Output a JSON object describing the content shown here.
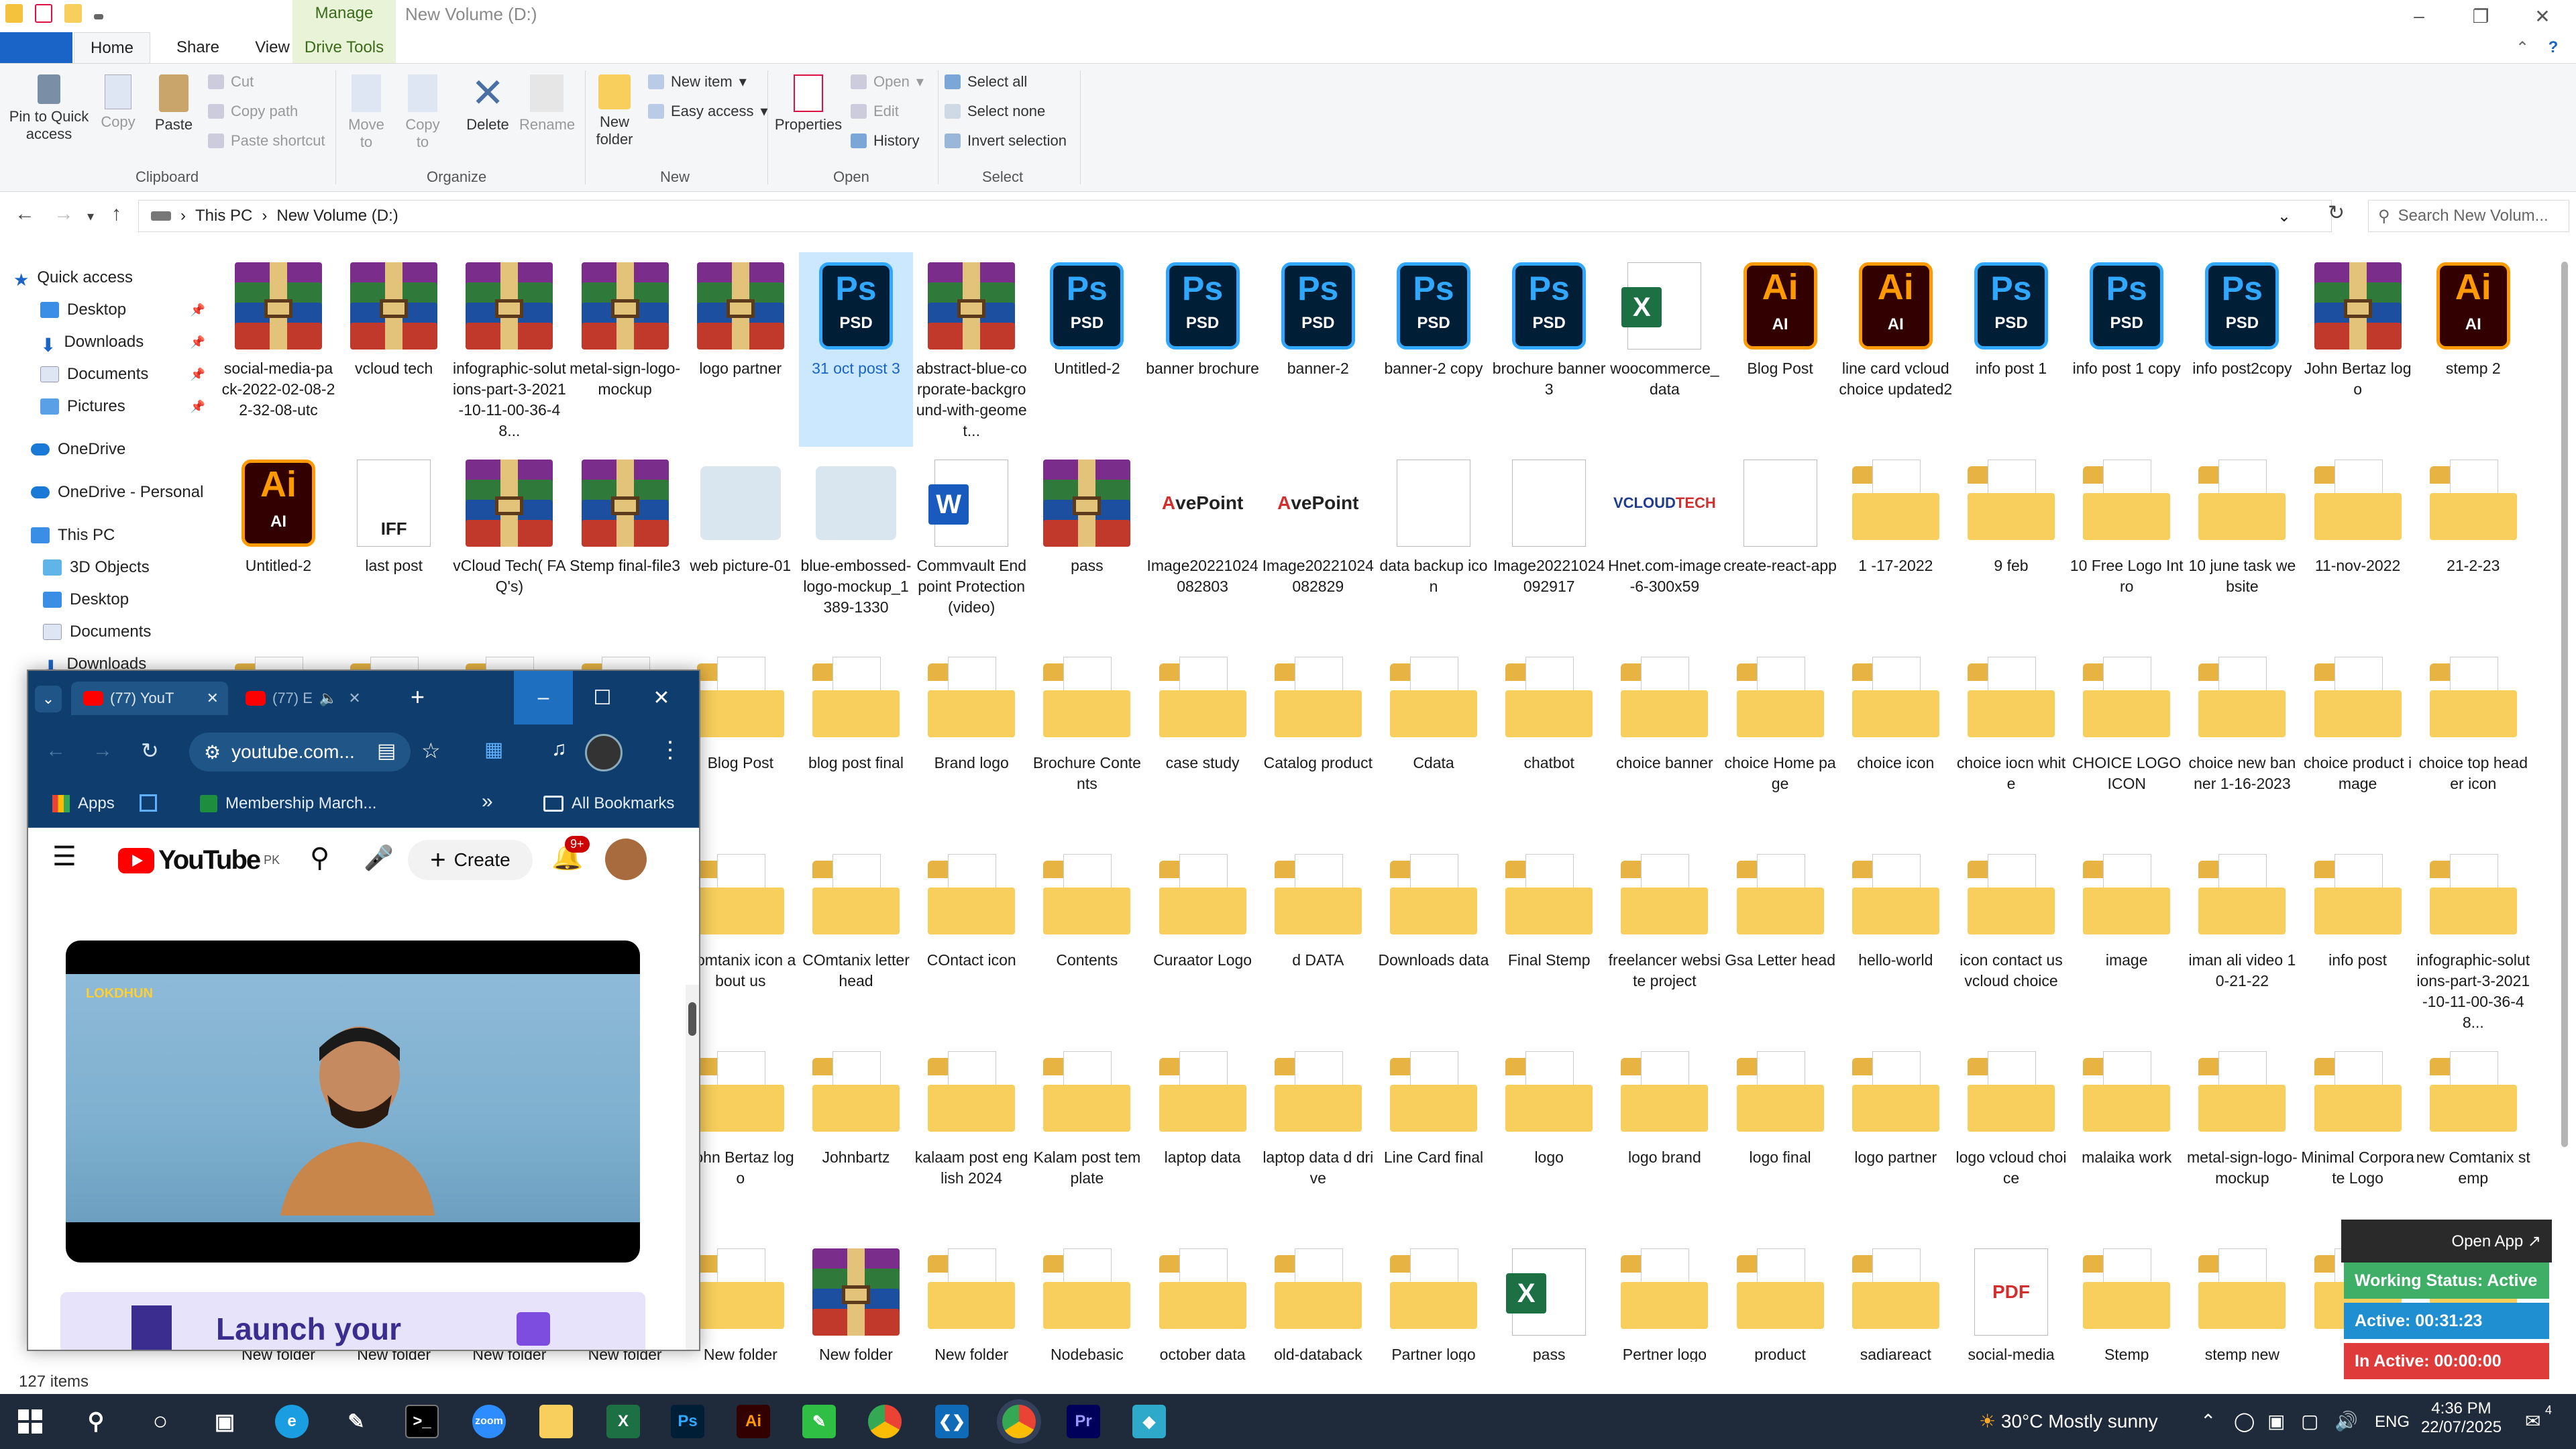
{
  "window": {
    "title": "New Volume (D:)",
    "context_tab": "Manage",
    "context_subtab": "Drive Tools"
  },
  "ribbon_tabs": [
    "File",
    "Home",
    "Share",
    "View"
  ],
  "ribbon": {
    "clipboard": {
      "label": "Clipboard",
      "pin": "Pin to Quick access",
      "copy": "Copy",
      "paste": "Paste",
      "cut": "Cut",
      "copy_path": "Copy path",
      "paste_shortcut": "Paste shortcut"
    },
    "organize": {
      "label": "Organize",
      "move_to": "Move to",
      "copy_to": "Copy to",
      "delete": "Delete",
      "rename": "Rename"
    },
    "new": {
      "label": "New",
      "new_folder": "New folder",
      "new_item": "New item",
      "easy_access": "Easy access"
    },
    "open": {
      "label": "Open",
      "properties": "Properties",
      "open": "Open",
      "edit": "Edit",
      "history": "History"
    },
    "select": {
      "label": "Select",
      "select_all": "Select all",
      "select_none": "Select none",
      "invert": "Invert selection"
    }
  },
  "address": {
    "this_pc": "This PC",
    "volume": "New Volume (D:)",
    "search_placeholder": "Search New Volum..."
  },
  "nav_pane": {
    "quick_access": "Quick access",
    "quick_items": [
      "Desktop",
      "Downloads",
      "Documents",
      "Pictures"
    ],
    "onedrive": "OneDrive",
    "onedrive_personal": "OneDrive - Personal",
    "this_pc": "This PC",
    "pc_items": [
      "3D Objects",
      "Desktop",
      "Documents",
      "Downloads"
    ]
  },
  "files": [
    {
      "name": "social-media-pack-2022-02-08-22-32-08-utc",
      "type": "rar"
    },
    {
      "name": "vcloud tech",
      "type": "rar"
    },
    {
      "name": "infographic-solutions-part-3-2021-10-11-00-36-48...",
      "type": "rar"
    },
    {
      "name": "metal-sign-logo-mockup",
      "type": "rar"
    },
    {
      "name": "logo partner",
      "type": "rar"
    },
    {
      "name": "31 oct post 3",
      "type": "psd",
      "selected": true
    },
    {
      "name": "abstract-blue-corporate-background-with-geomet...",
      "type": "rar"
    },
    {
      "name": "Untitled-2",
      "type": "psd"
    },
    {
      "name": "banner brochure",
      "type": "psd"
    },
    {
      "name": "banner-2",
      "type": "psd"
    },
    {
      "name": "banner-2 copy",
      "type": "psd"
    },
    {
      "name": "brochure banner 3",
      "type": "psd"
    },
    {
      "name": "woocommerce_data",
      "type": "xlsx"
    },
    {
      "name": "Blog Post",
      "type": "ai"
    },
    {
      "name": "line card vcloudchoice updated2",
      "type": "ai"
    },
    {
      "name": "info post 1",
      "type": "psd"
    },
    {
      "name": "info post 1 copy",
      "type": "psd"
    },
    {
      "name": "info post2copy",
      "type": "psd"
    },
    {
      "name": "John Bertaz logo",
      "type": "rar"
    },
    {
      "name": "stemp 2",
      "type": "ai"
    },
    {
      "name": "Untitled-2",
      "type": "ai"
    },
    {
      "name": "last post",
      "type": "iff"
    },
    {
      "name": "vCloud Tech( FAQ's)",
      "type": "rar"
    },
    {
      "name": "Stemp final-file3",
      "type": "rar"
    },
    {
      "name": "web picture-01",
      "type": "image"
    },
    {
      "name": "blue-embossed-logo-mockup_1389-1330",
      "type": "image"
    },
    {
      "name": "Commvault Endpoint Protection(video)",
      "type": "docx"
    },
    {
      "name": "pass",
      "type": "rar"
    },
    {
      "name": "Image20221024082803",
      "type": "avepoint"
    },
    {
      "name": "Image20221024082829",
      "type": "avepoint"
    },
    {
      "name": "data backup icon",
      "type": "blank"
    },
    {
      "name": "Image20221024092917",
      "type": "blank"
    },
    {
      "name": "Hnet.com-image-6-300x59",
      "type": "vcloud"
    },
    {
      "name": "create-react-app",
      "type": "blank"
    },
    {
      "name": "1 -17-2022",
      "type": "folder"
    },
    {
      "name": "9 feb",
      "type": "folder"
    },
    {
      "name": "10 Free Logo Intro",
      "type": "folder"
    },
    {
      "name": "10 june task website",
      "type": "folder"
    },
    {
      "name": "11-nov-2022",
      "type": "folder"
    },
    {
      "name": "21-2-23",
      "type": "folder"
    },
    {
      "name": "",
      "type": "folder"
    },
    {
      "name": "",
      "type": "folder"
    },
    {
      "name": "",
      "type": "folder"
    },
    {
      "name": "",
      "type": "folder"
    },
    {
      "name": "Blog Post",
      "type": "folder"
    },
    {
      "name": "blog post final",
      "type": "folder"
    },
    {
      "name": "Brand logo",
      "type": "folder"
    },
    {
      "name": "Brochure Contents",
      "type": "folder"
    },
    {
      "name": "case study",
      "type": "folder"
    },
    {
      "name": "Catalog product",
      "type": "folder"
    },
    {
      "name": "Cdata",
      "type": "folder"
    },
    {
      "name": "chatbot",
      "type": "folder"
    },
    {
      "name": "choice banner",
      "type": "folder"
    },
    {
      "name": "choice Home page",
      "type": "folder"
    },
    {
      "name": "choice icon",
      "type": "folder"
    },
    {
      "name": "choice iocn white",
      "type": "folder"
    },
    {
      "name": "CHOICE LOGO ICON",
      "type": "folder"
    },
    {
      "name": "choice new banner 1-16-2023",
      "type": "folder"
    },
    {
      "name": "choice product image",
      "type": "folder"
    },
    {
      "name": "choice top header icon",
      "type": "folder"
    },
    {
      "name": "",
      "type": "folder"
    },
    {
      "name": "",
      "type": "folder"
    },
    {
      "name": "",
      "type": "folder"
    },
    {
      "name": "",
      "type": "folder"
    },
    {
      "name": "Comtanix icon about us",
      "type": "folder"
    },
    {
      "name": "COmtanix letter head",
      "type": "folder"
    },
    {
      "name": "COntact icon",
      "type": "folder"
    },
    {
      "name": "Contents",
      "type": "folder"
    },
    {
      "name": "Curaator Logo",
      "type": "folder"
    },
    {
      "name": "d  DATA",
      "type": "folder"
    },
    {
      "name": "Downloads data",
      "type": "folder"
    },
    {
      "name": "Final Stemp",
      "type": "folder"
    },
    {
      "name": "freelancer website project",
      "type": "folder"
    },
    {
      "name": "Gsa Letter head",
      "type": "folder"
    },
    {
      "name": "hello-world",
      "type": "folder"
    },
    {
      "name": "icon contact us vcloud choice",
      "type": "folder"
    },
    {
      "name": "image",
      "type": "folder"
    },
    {
      "name": "iman ali video 10-21-22",
      "type": "folder"
    },
    {
      "name": "info post",
      "type": "folder"
    },
    {
      "name": "infographic-solutions-part-3-2021-10-11-00-36-48...",
      "type": "folder"
    },
    {
      "name": "",
      "type": "folder"
    },
    {
      "name": "",
      "type": "folder"
    },
    {
      "name": "",
      "type": "folder"
    },
    {
      "name": "",
      "type": "folder"
    },
    {
      "name": "John Bertaz logo",
      "type": "folder"
    },
    {
      "name": "Johnbartz",
      "type": "folder"
    },
    {
      "name": "kalaam post english 2024",
      "type": "folder"
    },
    {
      "name": "Kalam post template",
      "type": "folder"
    },
    {
      "name": "laptop data",
      "type": "folder"
    },
    {
      "name": "laptop data d drive",
      "type": "folder"
    },
    {
      "name": "Line Card final",
      "type": "folder"
    },
    {
      "name": "logo",
      "type": "folder"
    },
    {
      "name": "logo brand",
      "type": "folder"
    },
    {
      "name": "logo final",
      "type": "folder"
    },
    {
      "name": "logo partner",
      "type": "folder"
    },
    {
      "name": "logo vcloud choice",
      "type": "folder"
    },
    {
      "name": "malaika work",
      "type": "folder"
    },
    {
      "name": "metal-sign-logo-mockup",
      "type": "folder"
    },
    {
      "name": "Minimal Corporate Logo",
      "type": "folder"
    },
    {
      "name": "new Comtanix stemp",
      "type": "folder"
    },
    {
      "name": "New folder",
      "type": "folder"
    },
    {
      "name": "New folder",
      "type": "folder"
    },
    {
      "name": "New folder",
      "type": "folder"
    },
    {
      "name": "New folder",
      "type": "folder"
    },
    {
      "name": "New folder",
      "type": "folder"
    },
    {
      "name": "New folder",
      "type": "rar"
    },
    {
      "name": "New folder",
      "type": "folder"
    },
    {
      "name": "Nodebasic",
      "type": "folder"
    },
    {
      "name": "october data",
      "type": "folder"
    },
    {
      "name": "old-databack",
      "type": "folder"
    },
    {
      "name": "Partner logo",
      "type": "folder"
    },
    {
      "name": "pass",
      "type": "xlsx"
    },
    {
      "name": "Pertner logo",
      "type": "folder"
    },
    {
      "name": "product",
      "type": "folder"
    },
    {
      "name": "sadiareact",
      "type": "folder"
    },
    {
      "name": "social-media",
      "type": "pdf"
    },
    {
      "name": "Stemp",
      "type": "folder"
    },
    {
      "name": "stemp  new",
      "type": "folder"
    },
    {
      "name": "",
      "type": "folder"
    },
    {
      "name": "",
      "type": "folder"
    }
  ],
  "status_bar": {
    "items": "127 items"
  },
  "browser": {
    "tab1": "(77) YouT",
    "tab2": "(77) E",
    "url": "youtube.com...",
    "bookmarks": {
      "apps": "Apps",
      "membership": "Membership March...",
      "all": "All Bookmarks"
    },
    "yt_logo": "YouTube",
    "yt_region": "PK",
    "create": "Create",
    "notif_count": "9+",
    "video_watermark": "LOKDHUN",
    "banner": "Launch your"
  },
  "widget": {
    "open_app": "Open App ↗",
    "status": "Working Status: Active",
    "active": "Active: 00:31:23",
    "inactive": "In Active: 00:00:00"
  },
  "taskbar": {
    "weather": "30°C  Mostly sunny",
    "lang": "ENG",
    "time": "4:36 PM",
    "date": "22/07/2025",
    "notif": "4"
  },
  "colors": {
    "accent": "#1a64c8",
    "taskbar": "#1f2a3a",
    "browser_frame": "#0f3e6e",
    "widget_green": "#3fae66",
    "widget_blue": "#1f8fd1",
    "widget_red": "#e03b3b"
  }
}
